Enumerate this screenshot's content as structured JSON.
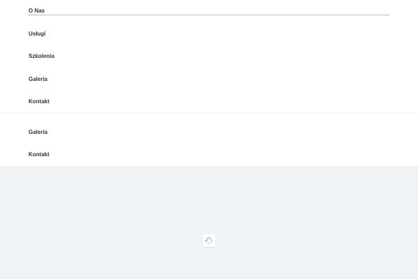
{
  "nav_primary": {
    "items": [
      {
        "label": "O Nas",
        "active": true
      },
      {
        "label": "Usługi"
      },
      {
        "label": "Szkolenia"
      },
      {
        "label": "Galeria"
      },
      {
        "label": "Kontakt"
      }
    ]
  },
  "nav_secondary": {
    "items": [
      {
        "label": "Galeria"
      },
      {
        "label": "Kontakt"
      }
    ]
  },
  "colors": {
    "active_underline": "#e3c23a",
    "content_background": "#f0f3f6",
    "nav_text": "#333333"
  },
  "icons": {
    "loading": "loading-spinner-icon"
  }
}
